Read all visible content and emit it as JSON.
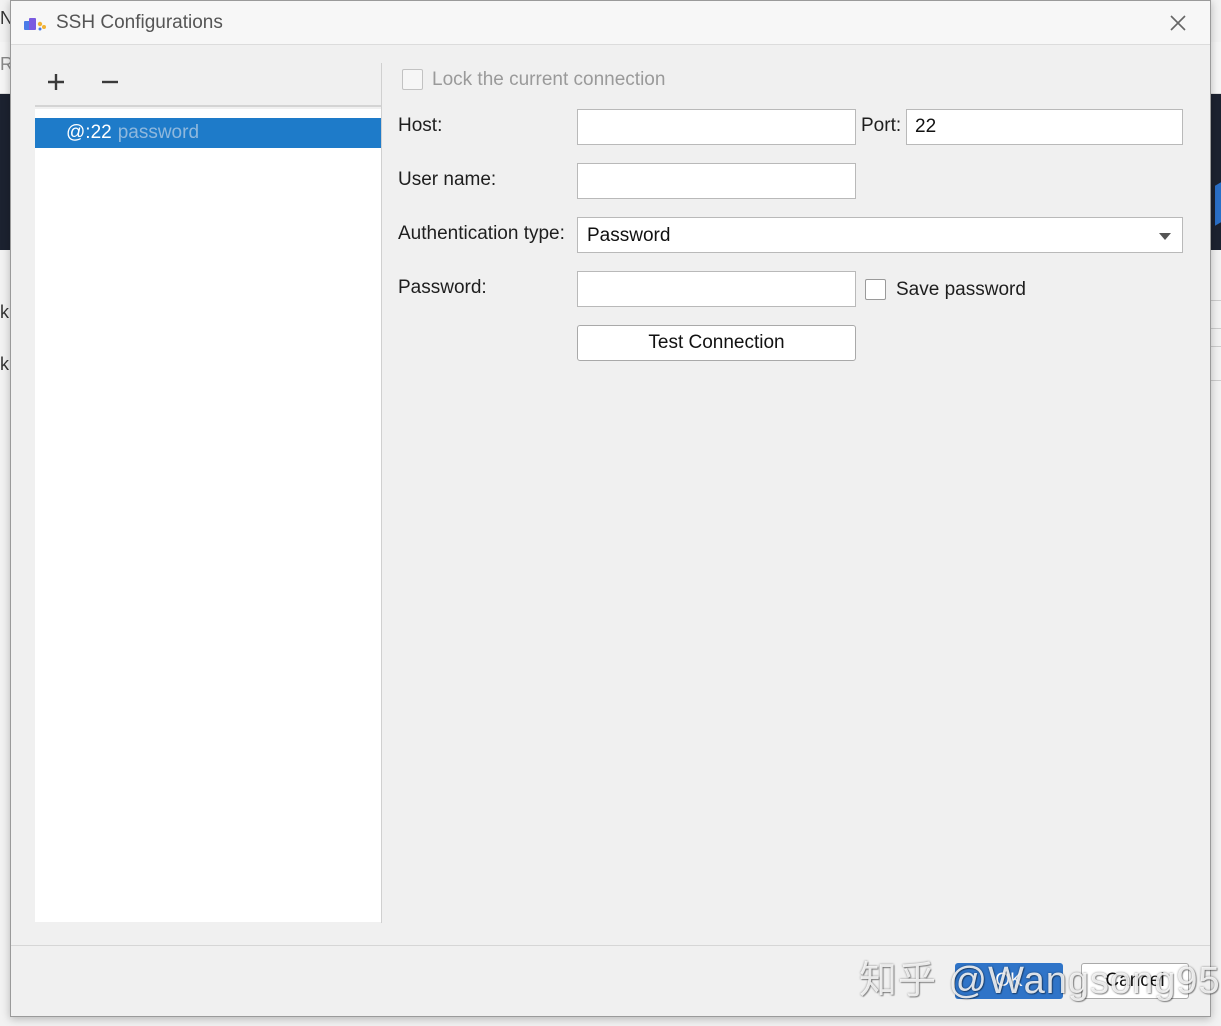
{
  "background": {
    "left_chars": [
      "N",
      "R",
      "k",
      "k"
    ]
  },
  "dialog": {
    "title": "SSH Configurations",
    "icons": {
      "app": "ssh-cloud-icon",
      "close": "close-icon",
      "add": "plus-icon",
      "remove": "minus-icon",
      "dropdown": "chevron-down-icon"
    }
  },
  "list": {
    "items": [
      {
        "label": "@:22",
        "hint": "password",
        "selected": true
      }
    ]
  },
  "form": {
    "lock_label": "Lock the current connection",
    "lock_checked": false,
    "host_label": "Host:",
    "host_value": "",
    "port_label": "Port:",
    "port_value": "22",
    "username_label": "User name:",
    "username_value": "",
    "auth_type_label": "Authentication type:",
    "auth_type_value": "Password",
    "password_label": "Password:",
    "password_value": "",
    "save_password_label": "Save password",
    "save_password_checked": false,
    "test_connection_label": "Test Connection"
  },
  "footer": {
    "ok_label": "OK",
    "cancel_label": "Cancel"
  },
  "watermark": "知乎 @Wangsong95",
  "colors": {
    "selection": "#1e7bc9",
    "ok_button": "#2f74c8",
    "dialog_bg": "#f0f0f0"
  }
}
